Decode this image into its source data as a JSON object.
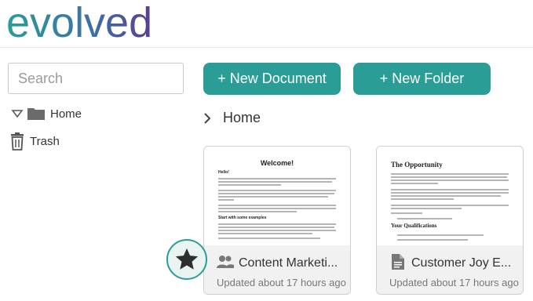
{
  "brand": {
    "logo_text": "evolved"
  },
  "search": {
    "placeholder": "Search"
  },
  "sidebar": {
    "items": [
      {
        "label": "Home",
        "icon": "folder-icon"
      },
      {
        "label": "Trash",
        "icon": "trash-icon"
      }
    ]
  },
  "toolbar": {
    "new_document": "+ New Document",
    "new_folder": "+ New Folder"
  },
  "breadcrumb": {
    "current": "Home"
  },
  "cards": [
    {
      "title": "Content Marketi...",
      "updated": "Updated about 17 hours ago",
      "icon": "people-icon",
      "preview": {
        "heading": "Welcome!",
        "lines": [
          "Hello!",
          "Start with some examples"
        ]
      }
    },
    {
      "title": "Customer Joy E...",
      "updated": "Updated about 17 hours ago",
      "icon": "document-icon",
      "preview": {
        "heading": "The Opportunity",
        "lines": [
          "Your Qualifications"
        ]
      }
    }
  ],
  "colors": {
    "accent": "#2a9d96",
    "logo_start": "#2a9d96",
    "logo_end": "#5b3e8f"
  }
}
